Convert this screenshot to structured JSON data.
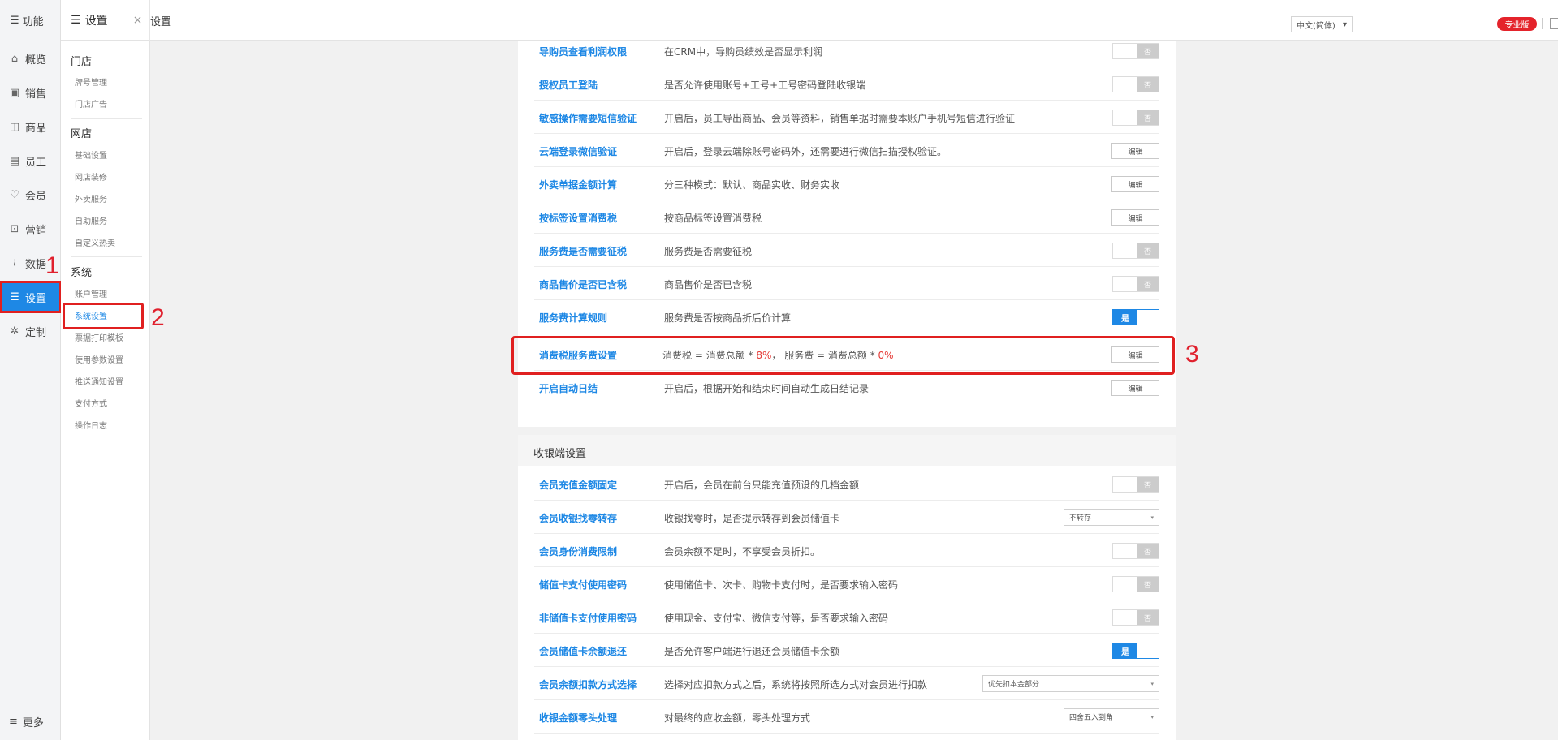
{
  "header": {
    "func_label": "功能",
    "settings_label": "设置",
    "close_symbol": "×",
    "breadcrumb": "设置",
    "language": "中文(简体)",
    "edition_badge": "专业版"
  },
  "nav": {
    "items": [
      {
        "label": "概览",
        "icon": "home-icon"
      },
      {
        "label": "销售",
        "icon": "sales-icon"
      },
      {
        "label": "商品",
        "icon": "goods-icon"
      },
      {
        "label": "员工",
        "icon": "employee-icon"
      },
      {
        "label": "会员",
        "icon": "member-icon"
      },
      {
        "label": "营销",
        "icon": "marketing-icon"
      },
      {
        "label": "数据",
        "icon": "data-icon"
      },
      {
        "label": "设置",
        "icon": "settings-icon",
        "active": true
      },
      {
        "label": "定制",
        "icon": "custom-icon"
      }
    ],
    "more_label": "更多"
  },
  "annotations": {
    "a1": "1",
    "a2": "2",
    "a3": "3"
  },
  "submenu": {
    "store": {
      "title": "门店",
      "links": [
        "牌号管理",
        "门店广告"
      ]
    },
    "online": {
      "title": "网店",
      "links": [
        "基础设置",
        "网店装修",
        "外卖服务",
        "自助服务",
        "自定义热卖"
      ]
    },
    "system": {
      "title": "系统",
      "links": [
        "账户管理",
        "系统设置",
        "票据打印模板",
        "使用参数设置",
        "推送通知设置",
        "支付方式",
        "操作日志"
      ]
    }
  },
  "section1": {
    "rows": [
      {
        "name": "导购员查看利润权限",
        "desc": "在CRM中，导购员绩效是否显示利润",
        "control": "toggle",
        "state": "否"
      },
      {
        "name": "授权员工登陆",
        "desc": "是否允许使用账号+工号+工号密码登陆收银端",
        "control": "toggle",
        "state": "否"
      },
      {
        "name": "敏感操作需要短信验证",
        "desc": "开启后，员工导出商品、会员等资料，销售单据时需要本账户手机号短信进行验证",
        "control": "toggle",
        "state": "否"
      },
      {
        "name": "云端登录微信验证",
        "desc": "开启后，登录云端除账号密码外，还需要进行微信扫描授权验证。",
        "control": "edit",
        "state": "编辑"
      },
      {
        "name": "外卖单据金额计算",
        "desc": "分三种模式：默认、商品实收、财务实收",
        "control": "edit",
        "state": "编辑"
      },
      {
        "name": "按标签设置消费税",
        "desc": "按商品标签设置消费税",
        "control": "edit",
        "state": "编辑"
      },
      {
        "name": "服务费是否需要征税",
        "desc": "服务费是否需要征税",
        "control": "toggle",
        "state": "否"
      },
      {
        "name": "商品售价是否已含税",
        "desc": "商品售价是否已含税",
        "control": "toggle",
        "state": "否"
      },
      {
        "name": "服务费计算规则",
        "desc": "服务费是否按商品折后价计算",
        "control": "toggle-on",
        "state": "是"
      },
      {
        "name": "消费税服务费设置",
        "desc_parts": [
          "消费税 = 消费总额 * ",
          "8%",
          "， 服务费 = 消费总额 * ",
          "0%"
        ],
        "control": "edit",
        "state": "编辑"
      },
      {
        "name": "开启自动日结",
        "desc": "开启后，根据开始和结束时间自动生成日结记录",
        "control": "edit",
        "state": "编辑"
      }
    ]
  },
  "section2": {
    "title": "收银端设置",
    "rows": [
      {
        "name": "会员充值金额固定",
        "desc": "开启后，会员在前台只能充值预设的几档金额",
        "control": "toggle",
        "state": "否"
      },
      {
        "name": "会员收银找零转存",
        "desc": "收银找零时，是否提示转存到会员储值卡",
        "control": "select",
        "state": "不转存"
      },
      {
        "name": "会员身份消费限制",
        "desc": "会员余额不足时，不享受会员折扣。",
        "control": "toggle",
        "state": "否"
      },
      {
        "name": "储值卡支付使用密码",
        "desc": "使用储值卡、次卡、购物卡支付时，是否要求输入密码",
        "control": "toggle",
        "state": "否"
      },
      {
        "name": "非储值卡支付使用密码",
        "desc": "使用现金、支付宝、微信支付等，是否要求输入密码",
        "control": "toggle",
        "state": "否"
      },
      {
        "name": "会员储值卡余额退还",
        "desc": "是否允许客户端进行退还会员储值卡余额",
        "control": "toggle-on",
        "state": "是"
      },
      {
        "name": "会员余额扣款方式选择",
        "desc": "选择对应扣款方式之后，系统将按照所选方式对会员进行扣款",
        "control": "select-wide",
        "state": "优先扣本金部分"
      },
      {
        "name": "收银金额零头处理",
        "desc": "对最终的应收金额，零头处理方式",
        "control": "select",
        "state": "四舍五入到角"
      }
    ]
  }
}
